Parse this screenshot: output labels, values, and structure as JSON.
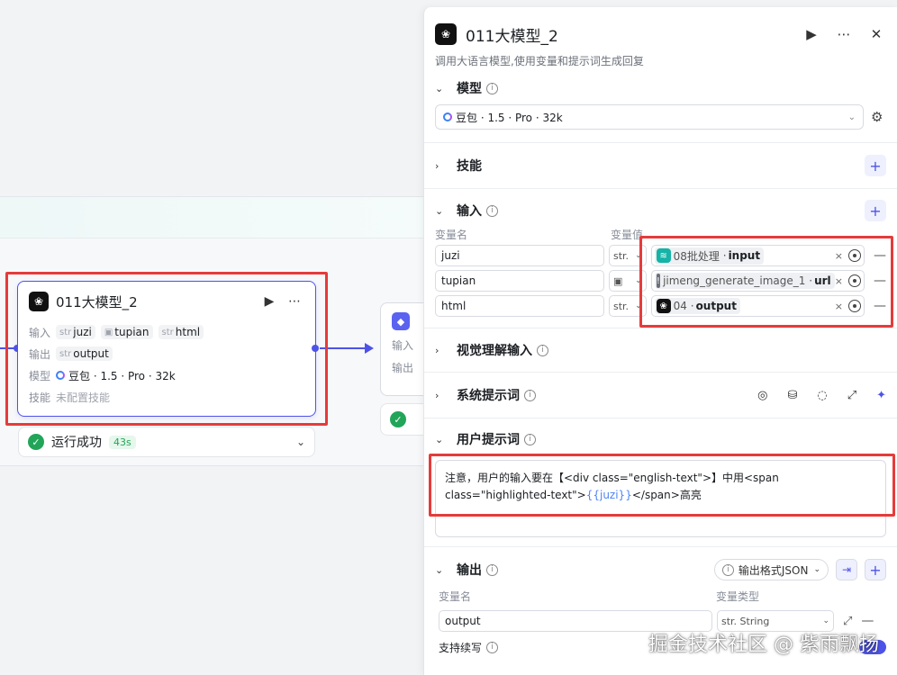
{
  "node": {
    "title": "011大模型_2",
    "input_label": "输入",
    "output_label": "输出",
    "model_label": "模型",
    "skill_label": "技能",
    "inputs": [
      {
        "type": "str",
        "name": "juzi"
      },
      {
        "type": "img",
        "name": "tupian"
      },
      {
        "type": "str",
        "name": "html"
      }
    ],
    "output": {
      "type": "str",
      "name": "output"
    },
    "model": "豆包 · 1.5 · Pro · 32k",
    "skill": "未配置技能",
    "status": "运行成功",
    "time": "43s"
  },
  "next_node": {
    "input_label": "输入",
    "output_label": "输出"
  },
  "panel": {
    "title": "011大模型_2",
    "description": "调用大语言模型,使用变量和提示词生成回复",
    "model_section": "模型",
    "model_value": "豆包 · 1.5 · Pro · 32k",
    "skills_section": "技能",
    "input_section": "输入",
    "col_name": "变量名",
    "col_value": "变量值",
    "inputs": [
      {
        "name": "juzi",
        "type": "str.",
        "ref_source": "08批处理",
        "ref_field": "input"
      },
      {
        "name": "tupian",
        "type": "img",
        "ref_source": "jimeng_generate_image_1",
        "ref_field": "url"
      },
      {
        "name": "html",
        "type": "str.",
        "ref_source": "04",
        "ref_field": "output"
      }
    ],
    "vision_section": "视觉理解输入",
    "system_prompt_section": "系统提示词",
    "user_prompt_section": "用户提示词",
    "user_prompt": {
      "before": "注意，用户的输入要在【<div class=\"english-text\">】中用<span class=\"highlighted-text\">",
      "var": "{{juzi}}",
      "after": "</span>高亮"
    },
    "output_section": "输出",
    "output_format": "输出格式JSON",
    "out_col_name": "变量名",
    "out_col_type": "变量类型",
    "out_var_name": "output",
    "out_var_type": "str. String",
    "streaming_label": "支持续写"
  },
  "watermark": "掘金技术社区 @ 紫雨飘扬",
  "colors": {
    "accent": "#4d53e8",
    "highlight": "#e53b3b",
    "success": "#22a559"
  }
}
